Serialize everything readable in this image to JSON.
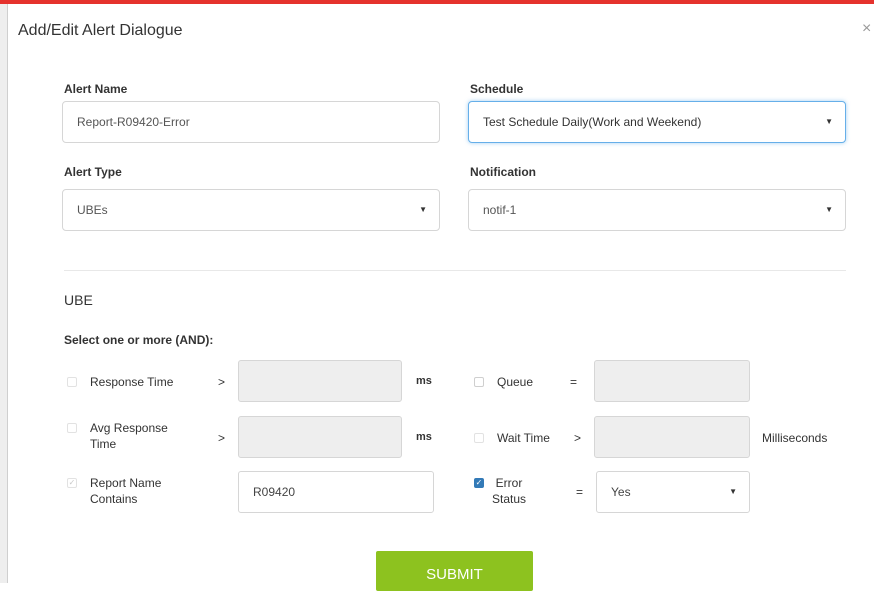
{
  "dialog": {
    "title": "Add/Edit Alert Dialogue",
    "close": "×"
  },
  "alert_name": {
    "label": "Alert Name",
    "value": "Report-R09420-Error"
  },
  "schedule": {
    "label": "Schedule",
    "value": "Test Schedule Daily(Work and Weekend)"
  },
  "alert_type": {
    "label": "Alert Type",
    "value": "UBEs"
  },
  "notification": {
    "label": "Notification",
    "value": "notif-1"
  },
  "ube": {
    "section_title": "UBE",
    "subtitle": "Select one or more (AND):",
    "response_time": {
      "label": "Response Time",
      "operator": ">",
      "value": "",
      "unit": "ms",
      "checked": false
    },
    "avg_response_time": {
      "label_line1": "Avg Response",
      "label_line2": "Time",
      "operator": ">",
      "value": "",
      "unit": "ms",
      "checked": false
    },
    "report_name": {
      "label_line1": "Report Name",
      "label_line2": "Contains",
      "value": "R09420",
      "checked": true
    },
    "queue": {
      "label": "Queue",
      "operator": "=",
      "value": "",
      "checked": false
    },
    "wait_time": {
      "label": "Wait Time",
      "operator": ">",
      "value": "",
      "unit": "Milliseconds",
      "checked": false
    },
    "error_status": {
      "label_line1": "Error",
      "label_line2": "Status",
      "operator": "=",
      "value": "Yes",
      "checked": true
    }
  },
  "submit_label": "SUBMIT",
  "colors": {
    "top_bar": "#e5322d",
    "submit": "#8dc21f",
    "focus": "#66afe9",
    "checkbox_checked": "#337ab7"
  }
}
